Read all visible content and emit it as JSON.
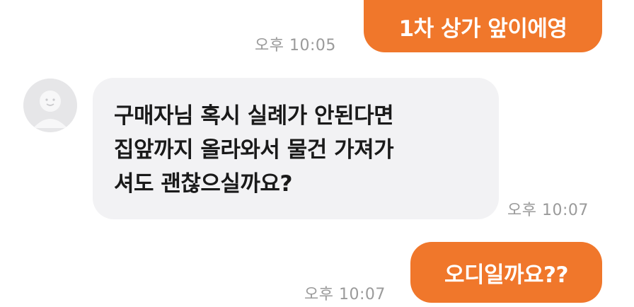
{
  "messages": [
    {
      "direction": "outgoing",
      "text": "1차 상가 앞이에영",
      "time": "오후 10:05"
    },
    {
      "direction": "incoming",
      "lines": [
        "구매자님 혹시 실례가 안된다면",
        "집앞까지 올라와서 물건 가져가",
        "셔도 괜찮으실까요?"
      ],
      "time": "오후 10:07"
    },
    {
      "direction": "outgoing",
      "text": "오디일까요??",
      "time": "오후 10:07"
    }
  ],
  "colors": {
    "outgoing_bubble": "#f0772b",
    "incoming_bubble": "#f2f2f4",
    "timestamp": "#9a9a9a"
  },
  "icons": {
    "avatar": "default-profile-icon"
  }
}
